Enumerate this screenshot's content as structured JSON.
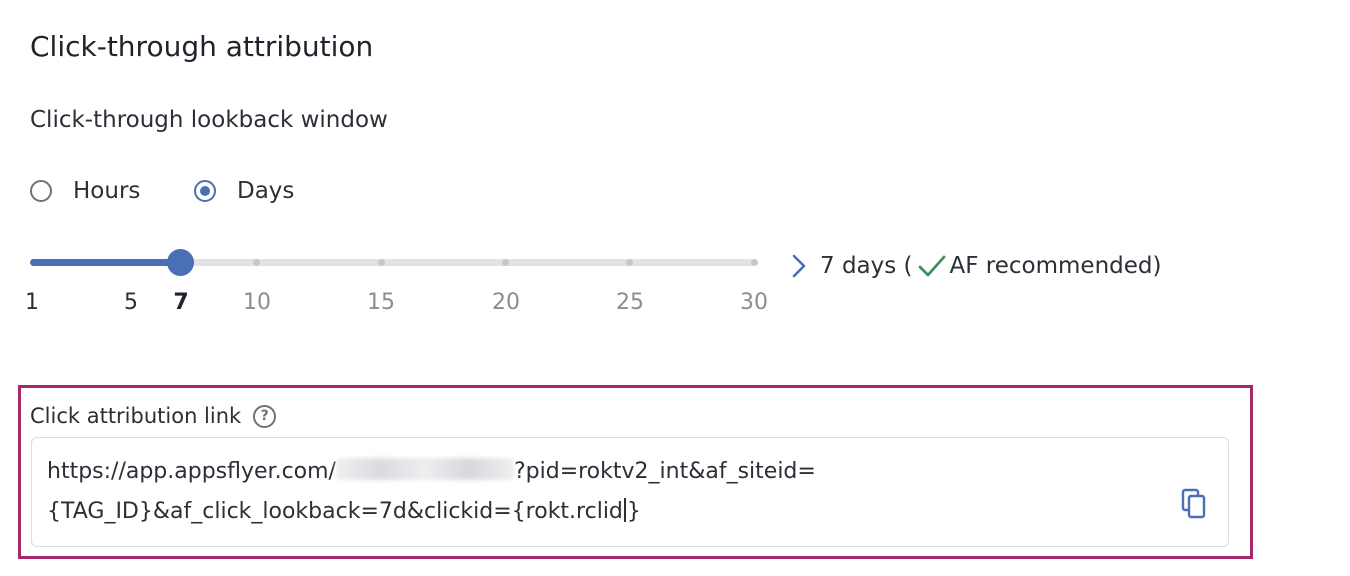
{
  "section": {
    "title": "Click-through attribution"
  },
  "lookback": {
    "label": "Click-through lookback window",
    "unit_options": [
      {
        "label": "Hours",
        "selected": false
      },
      {
        "label": "Days",
        "selected": true
      }
    ],
    "slider": {
      "min": 1,
      "max": 30,
      "value": 7,
      "ticks": [
        "1",
        "5",
        "7",
        "10",
        "15",
        "20",
        "25",
        "30"
      ]
    },
    "recommendation": {
      "prefix": "7 days (",
      "suffix": "AF recommended)",
      "chevron_icon": "chevron-right-icon",
      "check_icon": "check-icon"
    }
  },
  "attribution_link": {
    "label": "Click attribution link",
    "help_icon": "question-circle-icon",
    "url_prefix": "https://app.appsflyer.com/",
    "url_query": "?pid=roktv2_int&af_siteid=",
    "url_line2_before_caret": "{TAG_ID}&af_click_lookback=7d&clickid={rokt.rclid",
    "url_line2_after_caret": "}",
    "copy_icon": "copy-icon"
  },
  "colors": {
    "accent": "#4a6fb5",
    "highlight_border": "#a8286e",
    "check": "#3f8f5a"
  }
}
